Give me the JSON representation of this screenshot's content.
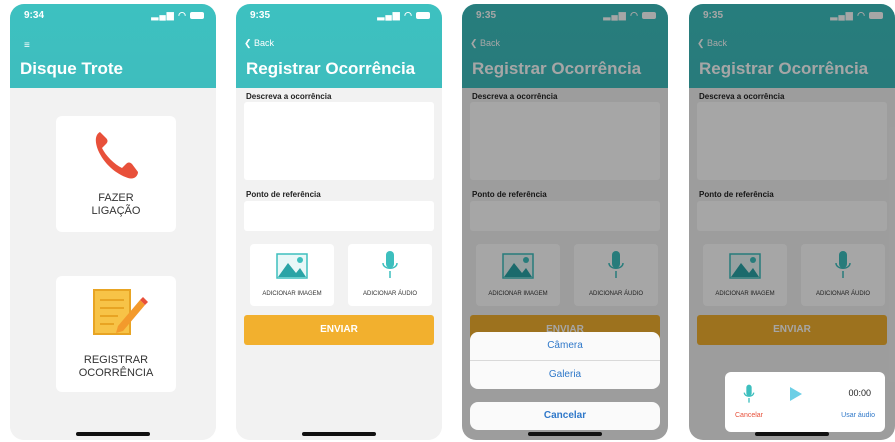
{
  "screens": {
    "home": {
      "time": "9:34",
      "title": "Disque Trote",
      "menu_icon": "hamburger-icon",
      "call_label_1": "FAZER",
      "call_label_2": "LIGAÇÃO",
      "register_label_1": "REGISTRAR",
      "register_label_2": "OCORRÊNCIA"
    },
    "form": {
      "time": "9:35",
      "back": "Back",
      "title": "Registrar Ocorrência",
      "describe_label": "Descreva a ocorrência",
      "reference_label": "Ponto de referência",
      "add_image": "ADICIONAR IMAGEM",
      "add_audio": "ADICIONAR ÁUDIO",
      "send": "ENVIAR"
    },
    "image_sheet": {
      "camera": "Câmera",
      "gallery": "Galeria",
      "cancel": "Cancelar",
      "send_partial": "ENVIAR"
    },
    "audio_popup": {
      "timer": "00:00",
      "cancel": "Cancelar",
      "use": "Usar áudio"
    }
  },
  "colors": {
    "teal": "#3dc1c0",
    "orange": "#f2b02e",
    "phone_red": "#e8503a",
    "link_blue": "#2f78c9"
  }
}
